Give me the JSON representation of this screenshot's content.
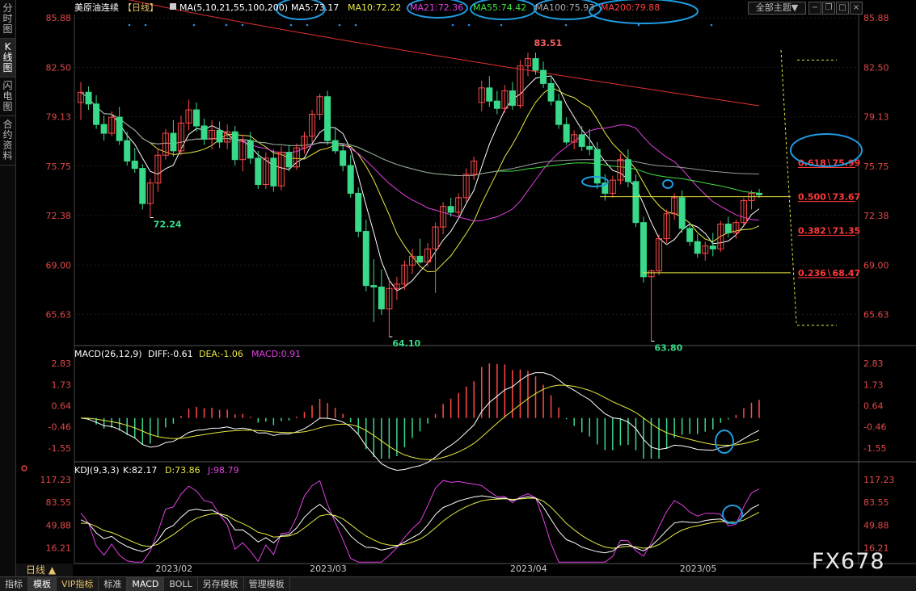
{
  "side_tabs": [
    "分时图",
    "K线图",
    "闪电图",
    "合约资料"
  ],
  "header": {
    "instrument": "美原油连续",
    "period": "【日线】",
    "ma_params": "MA(5,10,21,55,100,200)",
    "ma_values": [
      {
        "label": "MA5:73.17",
        "color": "#ffffff"
      },
      {
        "label": "MA10:72.22",
        "color": "#e8e840"
      },
      {
        "label": "MA21:72.36",
        "color": "#e040e0"
      },
      {
        "label": "MA55:74.42",
        "color": "#40e040"
      },
      {
        "label": "MA100:75.93",
        "color": "#aaaaaa"
      },
      {
        "label": "MA200:79.88",
        "color": "#ff4040"
      }
    ],
    "theme_button": "全部主题▼"
  },
  "price_axis": {
    "ticks": [
      "85.88",
      "82.50",
      "79.13",
      "75.75",
      "72.38",
      "69.00",
      "65.63"
    ]
  },
  "price_annotations": {
    "high": "83.51",
    "low1": "72.24",
    "low2": "64.10",
    "low3": "63.80"
  },
  "fib_labels": [
    "0.618∖75.99",
    "0.500∖73.67",
    "0.382∖71.35",
    "0.236∖68.47"
  ],
  "macd": {
    "title": "MACD(26,12,9)",
    "diff": "DIFF:-0.61",
    "dea": "DEA:-1.06",
    "macd": "MACD:0.91",
    "ticks": [
      "2.83",
      "1.73",
      "0.64",
      "-0.46",
      "-1.55"
    ]
  },
  "kdj": {
    "title": "KDJ(9,3,3)",
    "k": "K:82.17",
    "d": "D:73.86",
    "j": "J:98.79",
    "ticks": [
      "117.23",
      "83.55",
      "49.88",
      "16.21"
    ]
  },
  "x_axis": {
    "labels": [
      "2023/02",
      "2023/03",
      "2023/04",
      "2023/05"
    ]
  },
  "period_label": "日线 ▲",
  "bottom_tabs": [
    "指标",
    "模板",
    "VIP指标",
    "标准",
    "MACD",
    "BOLL",
    "另存模板",
    "管理模板"
  ],
  "watermark": "FX678",
  "chart_data": {
    "type": "candlestick",
    "title": "美原油连续 日线",
    "ylim": [
      63.5,
      86.0
    ],
    "candles": [
      [
        80.1,
        81.5,
        78.9,
        80.8
      ],
      [
        80.8,
        81.2,
        79.6,
        80.0
      ],
      [
        80.0,
        80.6,
        78.3,
        78.6
      ],
      [
        78.6,
        79.2,
        77.5,
        78.0
      ],
      [
        78.0,
        79.5,
        77.8,
        79.1
      ],
      [
        79.1,
        79.8,
        77.2,
        77.5
      ],
      [
        77.5,
        78.1,
        75.8,
        76.1
      ],
      [
        76.1,
        77.0,
        75.3,
        75.6
      ],
      [
        75.6,
        75.9,
        72.8,
        73.2
      ],
      [
        73.2,
        74.9,
        72.24,
        74.6
      ],
      [
        74.6,
        76.9,
        74.0,
        76.5
      ],
      [
        76.5,
        78.3,
        76.2,
        78.0
      ],
      [
        78.0,
        78.9,
        76.4,
        76.8
      ],
      [
        76.8,
        79.2,
        76.5,
        78.7
      ],
      [
        78.7,
        80.3,
        78.2,
        79.6
      ],
      [
        79.6,
        80.1,
        78.1,
        78.5
      ],
      [
        78.5,
        79.0,
        77.2,
        77.6
      ],
      [
        77.6,
        78.9,
        76.9,
        78.2
      ],
      [
        78.2,
        78.8,
        77.0,
        77.4
      ],
      [
        77.4,
        78.6,
        76.9,
        78.1
      ],
      [
        78.1,
        78.5,
        75.8,
        76.2
      ],
      [
        76.2,
        77.9,
        75.4,
        77.5
      ],
      [
        77.5,
        78.1,
        75.9,
        76.3
      ],
      [
        76.3,
        76.8,
        74.2,
        74.5
      ],
      [
        74.5,
        76.7,
        74.2,
        76.3
      ],
      [
        76.3,
        76.9,
        74.0,
        74.4
      ],
      [
        74.4,
        77.1,
        74.1,
        76.7
      ],
      [
        76.7,
        77.2,
        75.4,
        75.7
      ],
      [
        75.7,
        77.3,
        75.5,
        77.0
      ],
      [
        77.0,
        78.1,
        76.6,
        77.8
      ],
      [
        77.8,
        79.6,
        77.4,
        79.3
      ],
      [
        79.3,
        80.7,
        78.9,
        80.5
      ],
      [
        80.5,
        80.9,
        77.2,
        77.5
      ],
      [
        77.5,
        78.3,
        76.6,
        76.8
      ],
      [
        76.8,
        77.3,
        75.4,
        75.8
      ],
      [
        75.8,
        76.5,
        73.6,
        73.9
      ],
      [
        73.9,
        74.3,
        70.9,
        71.3
      ],
      [
        71.3,
        72.1,
        67.2,
        67.6
      ],
      [
        67.6,
        69.4,
        65.1,
        67.5
      ],
      [
        67.5,
        68.7,
        65.6,
        66.0
      ],
      [
        66.0,
        68.1,
        64.1,
        67.4
      ],
      [
        67.4,
        68.2,
        66.6,
        67.7
      ],
      [
        67.7,
        69.3,
        67.3,
        69.0
      ],
      [
        69.0,
        70.1,
        68.4,
        69.6
      ],
      [
        69.6,
        70.8,
        69.1,
        69.2
      ],
      [
        69.2,
        70.5,
        68.9,
        70.1
      ],
      [
        70.1,
        71.9,
        67.1,
        71.6
      ],
      [
        71.6,
        73.3,
        71.1,
        73.0
      ],
      [
        73.0,
        73.6,
        72.3,
        72.6
      ],
      [
        72.6,
        73.9,
        72.3,
        73.6
      ],
      [
        73.6,
        75.6,
        73.3,
        75.2
      ],
      [
        75.2,
        76.4,
        74.8,
        76.1
      ],
      [
        80.1,
        81.6,
        79.5,
        81.1
      ],
      [
        81.1,
        81.9,
        79.8,
        80.2
      ],
      [
        80.2,
        80.9,
        79.3,
        79.7
      ],
      [
        79.7,
        81.3,
        79.4,
        80.9
      ],
      [
        80.9,
        81.5,
        79.6,
        79.9
      ],
      [
        79.9,
        83.0,
        79.7,
        82.6
      ],
      [
        82.6,
        83.5,
        81.9,
        83.1
      ],
      [
        83.1,
        83.51,
        82.0,
        82.3
      ],
      [
        82.3,
        82.9,
        81.1,
        81.4
      ],
      [
        81.4,
        81.8,
        79.9,
        80.2
      ],
      [
        80.2,
        80.7,
        78.3,
        78.6
      ],
      [
        78.6,
        79.1,
        77.2,
        77.4
      ],
      [
        77.4,
        78.2,
        76.9,
        77.9
      ],
      [
        77.9,
        78.5,
        76.8,
        77.1
      ],
      [
        77.1,
        78.3,
        76.5,
        76.9
      ],
      [
        76.9,
        77.4,
        74.2,
        74.6
      ],
      [
        74.6,
        75.2,
        73.4,
        73.9
      ],
      [
        73.9,
        75.1,
        73.6,
        74.8
      ],
      [
        74.8,
        76.6,
        74.5,
        76.2
      ],
      [
        76.2,
        76.9,
        74.3,
        74.7
      ],
      [
        74.7,
        75.2,
        71.6,
        71.9
      ],
      [
        71.9,
        72.3,
        67.8,
        68.2
      ],
      [
        68.2,
        68.7,
        63.8,
        68.6
      ],
      [
        68.6,
        71.1,
        68.3,
        70.8
      ],
      [
        70.8,
        72.8,
        70.5,
        72.5
      ],
      [
        72.5,
        73.9,
        72.1,
        73.6
      ],
      [
        73.6,
        74.1,
        71.2,
        71.5
      ],
      [
        71.5,
        71.9,
        70.3,
        70.6
      ],
      [
        70.6,
        71.1,
        69.5,
        69.8
      ],
      [
        69.8,
        70.6,
        69.3,
        70.3
      ],
      [
        70.3,
        71.2,
        69.6,
        70.1
      ],
      [
        70.1,
        72.0,
        69.9,
        71.8
      ],
      [
        71.8,
        72.3,
        70.9,
        71.2
      ],
      [
        71.2,
        72.1,
        70.8,
        71.9
      ],
      [
        71.9,
        73.6,
        71.7,
        73.4
      ],
      [
        73.4,
        74.1,
        72.8,
        73.9
      ],
      [
        73.9,
        74.2,
        73.6,
        73.8
      ]
    ],
    "annotations": [
      {
        "label": "83.51",
        "type": "high"
      },
      {
        "label": "72.24",
        "type": "low"
      },
      {
        "label": "64.10",
        "type": "low"
      },
      {
        "label": "63.80",
        "type": "low"
      }
    ],
    "fibonacci": [
      {
        "ratio": 0.618,
        "value": 75.99
      },
      {
        "ratio": 0.5,
        "value": 73.67
      },
      {
        "ratio": 0.382,
        "value": 71.35
      },
      {
        "ratio": 0.236,
        "value": 68.47
      }
    ],
    "moving_averages_current": {
      "MA5": 73.17,
      "MA10": 72.22,
      "MA21": 72.36,
      "MA55": 74.42,
      "MA100": 75.93,
      "MA200": 79.88
    },
    "macd_current": {
      "DIFF": -0.61,
      "DEA": -1.06,
      "MACD": 0.91
    },
    "macd_ylim": [
      -2.1,
      2.83
    ],
    "kdj_current": {
      "K": 82.17,
      "D": 73.86,
      "J": 98.79
    },
    "kdj_ylim": [
      0,
      117.23
    ],
    "x_labels": [
      "2023/02",
      "2023/03",
      "2023/04",
      "2023/05"
    ]
  }
}
